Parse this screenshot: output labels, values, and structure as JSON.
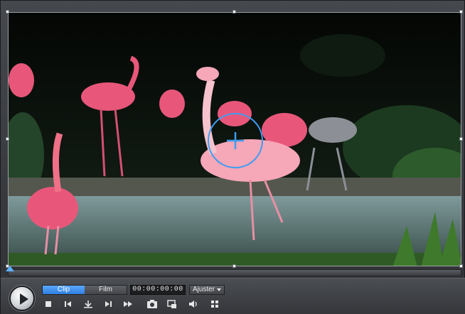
{
  "player": {
    "tabs": [
      {
        "label": "Clip",
        "active": true
      },
      {
        "label": "Film",
        "active": false
      }
    ],
    "timecode": "00:00:00:00",
    "fit_option": "Ajuster",
    "accent_color": "#3a8ef0"
  },
  "controls": {
    "icons": [
      "stop-icon",
      "previous-frame-icon",
      "trim-icon",
      "next-frame-icon",
      "fast-forward-icon",
      "snapshot-icon",
      "resize-icon",
      "volume-icon",
      "settings-icon"
    ]
  }
}
